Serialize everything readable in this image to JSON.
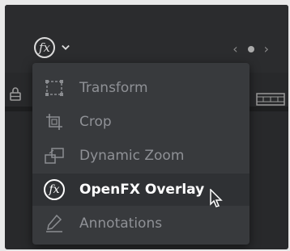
{
  "toolbar": {
    "fx_icon_label": "fx",
    "nav_prev": "‹",
    "nav_next": "›"
  },
  "menu": {
    "items": [
      {
        "label": "Transform",
        "icon": "transform-icon",
        "active": false
      },
      {
        "label": "Crop",
        "icon": "crop-icon",
        "active": false
      },
      {
        "label": "Dynamic Zoom",
        "icon": "dynamic-zoom-icon",
        "active": false
      },
      {
        "label": "OpenFX Overlay",
        "icon": "openfx-icon",
        "icon_text": "fx",
        "active": true
      },
      {
        "label": "Annotations",
        "icon": "annotation-pen-icon",
        "active": false
      }
    ]
  },
  "colors": {
    "background": "#28292b",
    "menu_bg": "#383a3d",
    "active_item_bg": "#2f3134",
    "inactive_text": "#8f9196",
    "active_text": "#ffffff"
  }
}
